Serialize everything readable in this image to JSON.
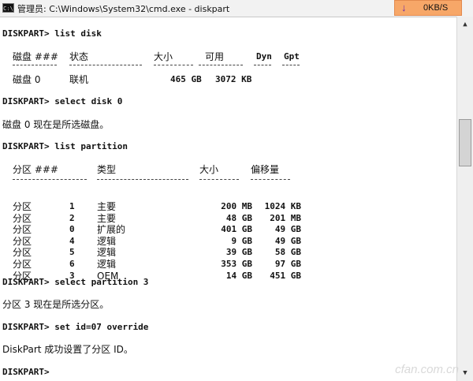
{
  "window": {
    "icon_text": "C:\\",
    "title": "管理员: C:\\Windows\\System32\\cmd.exe - diskpart",
    "speed": "0KB/S"
  },
  "console": {
    "cmd1": "DISKPART> list disk",
    "disk_headers": [
      "磁盘 ###",
      "状态",
      "大小",
      "可用",
      "Dyn",
      "Gpt"
    ],
    "disk_row": [
      "磁盘 0",
      "联机",
      "465 GB",
      "3072 KB"
    ],
    "cmd2": "DISKPART> select disk 0",
    "msg2": "磁盘 0 现在是所选磁盘。",
    "cmd3": "DISKPART> list partition",
    "part_headers": [
      "分区 ###",
      "类型",
      "大小",
      "偏移量"
    ],
    "partitions": [
      {
        "name": "分区",
        "num": "1",
        "type": "主要",
        "size": "200 MB",
        "offset": "1024 KB"
      },
      {
        "name": "分区",
        "num": "2",
        "type": "主要",
        "size": "48 GB",
        "offset": "201 MB"
      },
      {
        "name": "分区",
        "num": "0",
        "type": "扩展的",
        "size": "401 GB",
        "offset": "49 GB"
      },
      {
        "name": "分区",
        "num": "4",
        "type": "逻辑",
        "size": "9 GB",
        "offset": "49 GB"
      },
      {
        "name": "分区",
        "num": "5",
        "type": "逻辑",
        "size": "39 GB",
        "offset": "58 GB"
      },
      {
        "name": "分区",
        "num": "6",
        "type": "逻辑",
        "size": "353 GB",
        "offset": "97 GB"
      },
      {
        "name": "分区",
        "num": "3",
        "type": "OEM",
        "size": "14 GB",
        "offset": "451 GB"
      }
    ],
    "cmd4": "DISKPART> select partition 3",
    "msg4": "分区 3 现在是所选分区。",
    "cmd5": "DISKPART> set id=07 override",
    "msg5": "DiskPart 成功设置了分区 ID。",
    "prompt": "DISKPART>"
  },
  "watermark": "cfan.com.cn"
}
